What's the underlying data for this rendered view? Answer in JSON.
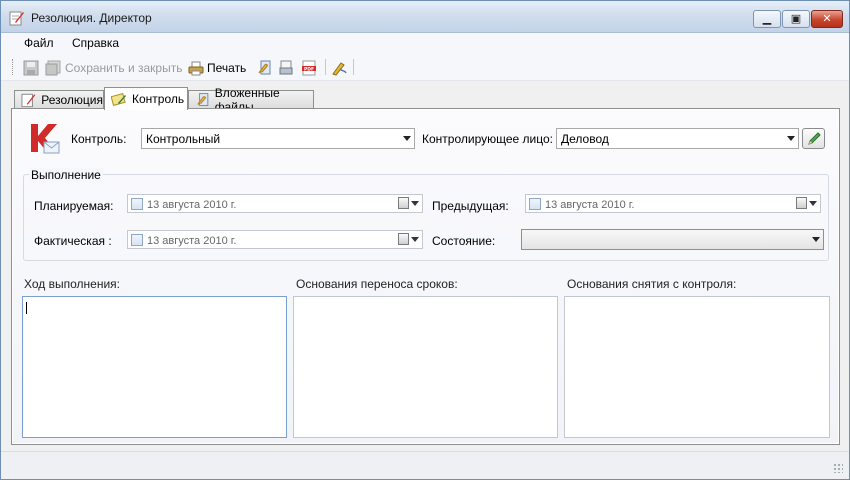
{
  "window": {
    "title": "Резолюция. Директор"
  },
  "menu": {
    "file": "Файл",
    "help": "Справка"
  },
  "toolbar": {
    "save_close": "Сохранить и закрыть",
    "print": "Печать"
  },
  "tabs": [
    {
      "label": "Резолюция"
    },
    {
      "label": "Контроль"
    },
    {
      "label": "Вложенные файлы"
    }
  ],
  "control": {
    "label": "Контроль:",
    "value": "Контрольный",
    "person_label": "Контролирующее лицо:",
    "person_value": "Деловод"
  },
  "execution": {
    "group_title": "Выполнение",
    "planned_label": "Планируемая:",
    "planned_value": "13  августа  2010 г.",
    "previous_label": "Предыдущая:",
    "previous_value": "13  августа  2010 г.",
    "actual_label": "Фактическая :",
    "actual_value": "13  августа  2010 г.",
    "state_label": "Состояние:",
    "state_value": ""
  },
  "memos": {
    "progress_label": "Ход выполнения:",
    "reschedule_label": "Основания переноса сроков:",
    "removal_label": "Основания снятия с контроля:"
  },
  "colors": {
    "titlebar": "#cfdcec",
    "close_button": "#c7452d",
    "accent": "#d32f2f"
  }
}
